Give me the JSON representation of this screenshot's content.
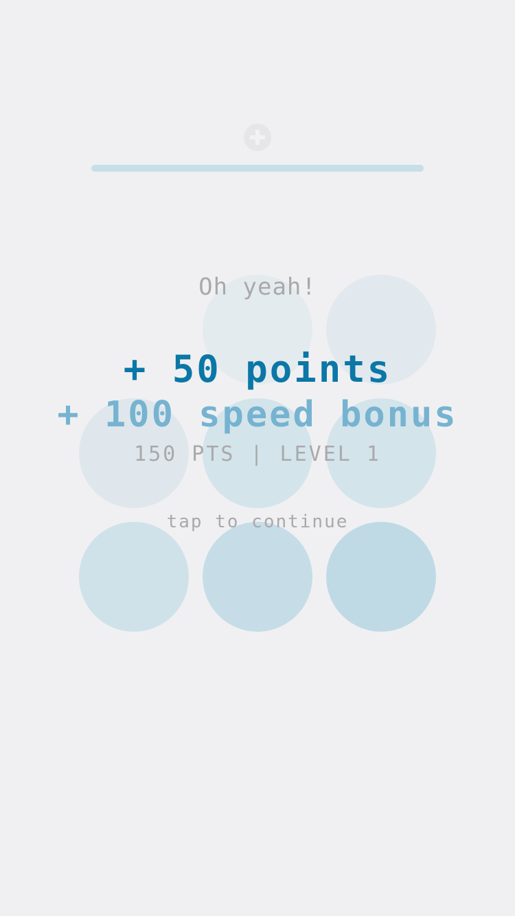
{
  "header": {
    "icon": "plus-circle-icon",
    "progress": 1.0,
    "progress_color": "#c6dfe8"
  },
  "board": {
    "circles": [
      {
        "row": 0,
        "col": 1,
        "color": "#e4ebef"
      },
      {
        "row": 0,
        "col": 2,
        "color": "#e1e9ee"
      },
      {
        "row": 1,
        "col": 0,
        "color": "#dfe7ec"
      },
      {
        "row": 1,
        "col": 1,
        "color": "#d4e4eb"
      },
      {
        "row": 1,
        "col": 2,
        "color": "#d4e4eb"
      },
      {
        "row": 2,
        "col": 0,
        "color": "#cfe2e9"
      },
      {
        "row": 2,
        "col": 1,
        "color": "#c6dde7"
      },
      {
        "row": 2,
        "col": 2,
        "color": "#c0dae5"
      }
    ]
  },
  "result": {
    "message": "Oh yeah!",
    "points": "+ 50 points",
    "bonus": "+ 100 speed bonus",
    "score": "150 PTS",
    "separator": "|",
    "level": "LEVEL 1",
    "prompt": "tap to continue"
  },
  "colors": {
    "background": "#f0f0f2",
    "points": "#0b77a6",
    "bonus": "#76b3d0",
    "muted_text": "#a9a9ab"
  }
}
